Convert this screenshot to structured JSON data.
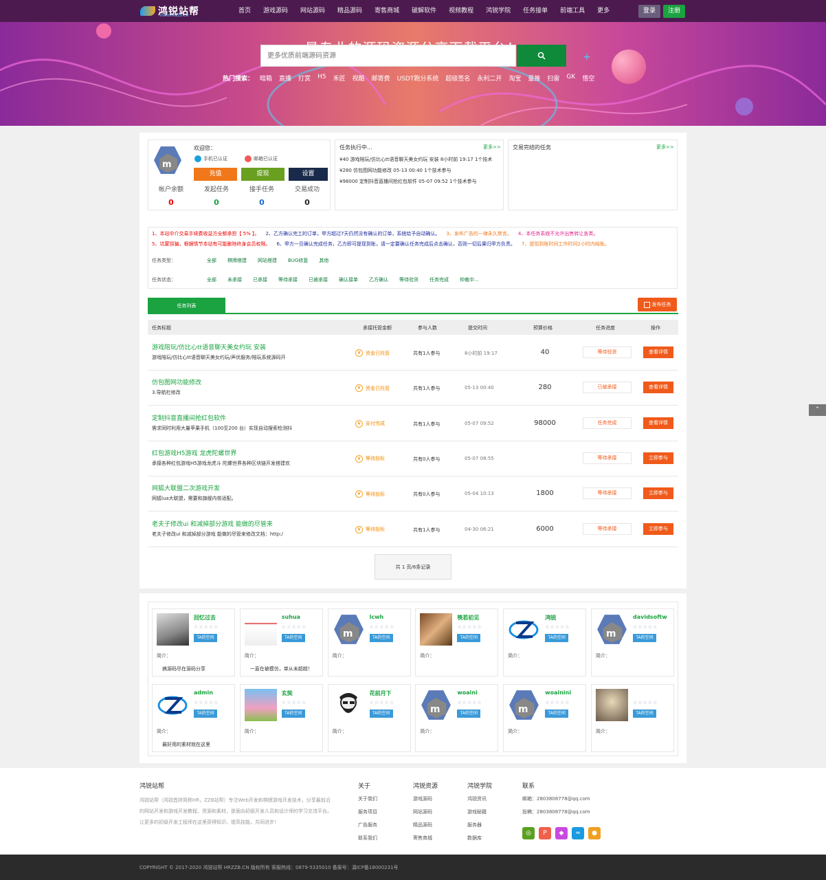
{
  "header": {
    "logo_text": "鸿锐站帮",
    "logo_sub": "WWW.HRZZB.CN",
    "nav": [
      "首页",
      "游戏源码",
      "网站源码",
      "精品源码",
      "寄售商城",
      "破解软件",
      "视频教程",
      "鸿锐学院",
      "任务接单",
      "前端工具",
      "更多"
    ],
    "login": "登录",
    "register": "注册"
  },
  "hero": {
    "title": "最专业的源码资源分享下载平台！",
    "search_placeholder": "更多优质前端源码资源",
    "hot_label": "热门搜索：",
    "hot": [
      "暗箱",
      "直播",
      "打赏",
      "H5",
      "禾匠",
      "视酷",
      "邮寄费",
      "USDT跑分系统",
      "超级签名",
      "永利二开",
      "淘宝",
      "量推",
      "扫雷",
      "GK",
      "悟空"
    ]
  },
  "user": {
    "welcome": "欢迎您：",
    "phone_cert": "手机已认证",
    "email_cert": "邮箱已认证",
    "recharge": "充值",
    "withdraw": "提现",
    "settings": "设置",
    "stats": [
      {
        "label": "帐户余额",
        "value": "0"
      },
      {
        "label": "发起任务",
        "value": "0"
      },
      {
        "label": "接手任务",
        "value": "0"
      },
      {
        "label": "交易成功",
        "value": "0"
      }
    ]
  },
  "running": {
    "title": "任务执行中...",
    "more": "更多>>",
    "lines": [
      "¥40 游戏陪玩/仿比心tt语音聊天美女约玩 安装 8小时前 19:17 1个技术",
      "¥280 仿包图网功能修改 05-13 00:40 1个技术参与",
      "¥98000 定制抖音直播间抢红包软件 05-07 09:52 1个技术参与"
    ]
  },
  "done": {
    "title": "交易完结的任务",
    "more": "更多>>"
  },
  "notices": {
    "line1": [
      "1、本站中介交易手续费收益方全额承担【 5% 】。",
      "2、乙方确认完工的订单，甲方超过7天仍然没有确认的订单，系统给予自动确认。",
      "3、发布广告的一律永久禁言。",
      "4、本任务系统不允许出售转让各类。"
    ],
    "line2": [
      "5、坑蒙拐骗，根据情节本站有可能删除终身会员权限。",
      "6、甲方一旦确认完成任务，乙方即可提现到账，请一定要确认任务完成后点击确认，否则一切后果归甲方负责。",
      "7、提现到账时间工作时间2小时内结账。"
    ]
  },
  "filters": {
    "type_label": "任务类型：",
    "types": [
      "全部",
      "棋牌搭建",
      "网站搭建",
      "BUG修复",
      "其他"
    ],
    "status_label": "任务状态：",
    "statuses": [
      "全部",
      "未承接",
      "已承接",
      "等待承接",
      "已被承接",
      "确认接单",
      "乙方确认",
      "等待验货",
      "任务完成",
      "仲裁中..."
    ]
  },
  "tasks": {
    "tab": "任务列表",
    "publish": "发布任务",
    "columns": [
      "任务标题",
      "承接托管金额",
      "参与人数",
      "提交时间",
      "预算价格",
      "任务进度",
      "操作"
    ],
    "rows": [
      {
        "title": "游戏陪玩/仿比心tt语音聊天美女约玩 安装",
        "desc": "游戏陪玩/仿比心tt语音聊天美女约玩/声优服务/陪玩系统源码开",
        "pay": "资金已托管",
        "count": "共有1人参与",
        "time": "8小时前 19:17",
        "price": "40",
        "status": "等待验货",
        "op": "查看详情"
      },
      {
        "title": "仿包图网功能修改",
        "desc": "3.导航栏修改",
        "pay": "资金已托管",
        "count": "共有1人参与",
        "time": "05-13 00:40",
        "price": "280",
        "status": "已被承接",
        "op": "查看详情"
      },
      {
        "title": "定制抖音直播间抢红包软件",
        "desc": "需求同时利用大量苹果手机（100至200 台）实现自动搜索检测抖",
        "pay": "支付完成",
        "count": "共有1人参与",
        "time": "05-07 09:52",
        "price": "98000",
        "status": "任务完成",
        "op": "查看详情"
      },
      {
        "title": "红包游戏H5游戏 龙虎陀螺世界",
        "desc": "承接各种红包游戏H5游戏龙虎斗 陀螺世界各种区块链开发搭建欢",
        "pay": "等待投标",
        "count": "共有0人参与",
        "time": "05-07 08:55",
        "price": "",
        "status": "等待承接",
        "op": "立即参与"
      },
      {
        "title": "网狐大联盟二次游戏开发",
        "desc": "网狐lua大联盟，需要和旗舰内核适配。",
        "pay": "等待投标",
        "count": "共有0人参与",
        "time": "05-04 10:13",
        "price": "1800",
        "status": "等待承接",
        "op": "立即参与"
      },
      {
        "title": "老夫子修改ui 和减掉部分游戏 能做的尽管来",
        "desc": "老夫子修改ui 和减掉部分游戏 能做的尽管来修改文档：http:/",
        "pay": "等待投标",
        "count": "共有1人参与",
        "time": "04-30 06:21",
        "price": "6000",
        "status": "等待承接",
        "op": "立即参与"
      }
    ],
    "pager": "共 1 页/6条记录"
  },
  "members": [
    {
      "name": "回忆过去",
      "badge": "TA的空间",
      "intro": "简介：",
      "text": "搞源码尽在源码分享",
      "av": "photo1"
    },
    {
      "name": "suhua",
      "badge": "TA的空间",
      "intro": "简介：",
      "text": "一直在被模仿，单从未超越！",
      "av": "shot"
    },
    {
      "name": "lcwh",
      "badge": "TA的空间",
      "intro": "简介：",
      "text": "",
      "av": "default"
    },
    {
      "name": "筷若初见",
      "badge": "TA的空间",
      "intro": "简介：",
      "text": "",
      "av": "photo2"
    },
    {
      "name": "鸿锐",
      "badge": "TA的空间",
      "intro": "简介：",
      "text": "",
      "av": "logo"
    },
    {
      "name": "davidsoftw",
      "badge": "TA的空间",
      "intro": "简介：",
      "text": "",
      "av": "default"
    },
    {
      "name": "admin",
      "badge": "TA的空间",
      "intro": "简介：",
      "text": "最好用的素材就在这里",
      "av": "logo"
    },
    {
      "name": "玄奘",
      "badge": "TA的空间",
      "intro": "简介：",
      "text": "",
      "av": "pig"
    },
    {
      "name": "花前月下",
      "badge": "TA的空间",
      "intro": "简介：",
      "text": "",
      "av": "beard"
    },
    {
      "name": "woaini",
      "badge": "TA的空间",
      "intro": "简介：",
      "text": "",
      "av": "default"
    },
    {
      "name": "woainini",
      "badge": "TA的空间",
      "intro": "简介：",
      "text": "",
      "av": "default"
    },
    {
      "name": "",
      "badge": "TA的空间",
      "intro": "简介：",
      "text": "",
      "av": "photo3"
    }
  ],
  "footer": {
    "about_title": "鸿锐站帮",
    "about_text": "鸿锐站帮（鸿锐首拼简称HR，ZZB站帮）专注Web开发和棋牌游戏开发技术，分享最前沿的网站开发和游戏开发教程、资源和素材，是面向初级开发人员和设计师的学习交流平台。让更多的初级开发工程师在这里获得知识、提高技能，共同进步！",
    "cols": [
      {
        "title": "关于",
        "items": [
          "关于我们",
          "服务项目",
          "广告服务",
          "联系我们"
        ]
      },
      {
        "title": "鸿锐资源",
        "items": [
          "游戏源码",
          "网站源码",
          "精品源码",
          "寄售商城"
        ]
      },
      {
        "title": "鸿锐学院",
        "items": [
          "鸿锐资讯",
          "游戏秘籍",
          "服务器",
          "数据库"
        ]
      }
    ],
    "contact_title": "联系",
    "mail": "邮箱：2803808778@qq.com",
    "tougao": "投稿：2803808778@qq.com",
    "copyright": "COPYRIGHT © 2017-2020 鸿锐站帮 HRZZB.CN 版权所有 客服热线：0879-5335010 备案号：滇ICP备18000231号"
  }
}
